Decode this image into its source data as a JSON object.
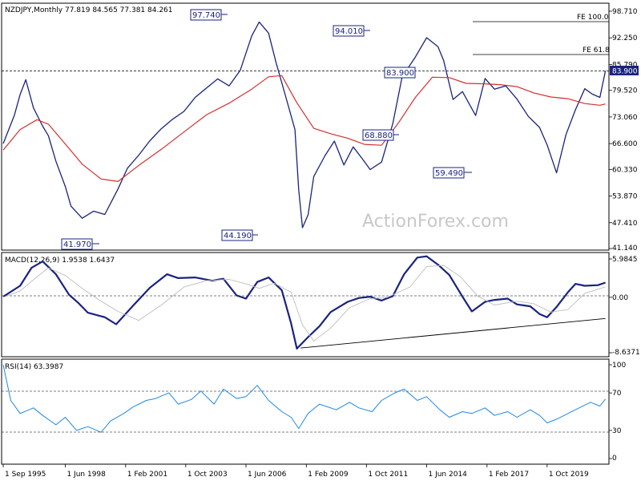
{
  "chart_data": [
    {
      "type": "line",
      "header": "NZDJPY,Monthly  77.819 84.565 77.381 84.261",
      "ylim": [
        41.14,
        98.71
      ],
      "y_ticks": [
        "98.710",
        "92.250",
        "85.790",
        "79.520",
        "73.060",
        "66.600",
        "60.330",
        "53.870",
        "47.410",
        "41.140"
      ],
      "current_price": 83.9,
      "current_price_label": "83.900",
      "x_ticks": [
        "1 Sep 1995",
        "1 Jun 1998",
        "1 Feb 2001",
        "1 Oct 2003",
        "1 Jun 2006",
        "1 Feb 2009",
        "1 Oct 2011",
        "1 Jun 2014",
        "1 Feb 2017",
        "1 Oct 2019"
      ],
      "series": [
        {
          "color": "#1a237e",
          "x": [
            "1995-09",
            "1996-03",
            "1996-06",
            "1996-09",
            "1997-01",
            "1997-06",
            "1997-09",
            "1998-01",
            "1998-06",
            "1998-09",
            "1999-03",
            "1999-09",
            "2000-03",
            "2000-10",
            "2001-03",
            "2001-09",
            "2002-03",
            "2002-09",
            "2003-03",
            "2003-09",
            "2004-03",
            "2004-09",
            "2005-03",
            "2005-09",
            "2006-03",
            "2006-09",
            "2007-01",
            "2007-06",
            "2007-10",
            "2008-03",
            "2008-08",
            "2008-10",
            "2008-12",
            "2009-03",
            "2009-06",
            "2009-12",
            "2010-05",
            "2010-10",
            "2011-03",
            "2011-08",
            "2011-12",
            "2012-06",
            "2012-12",
            "2013-05",
            "2013-12",
            "2014-06",
            "2014-12",
            "2015-03",
            "2015-08",
            "2016-01",
            "2016-08",
            "2017-01",
            "2017-06",
            "2017-12",
            "2018-06",
            "2018-12",
            "2019-06",
            "2019-10",
            "2020-03",
            "2020-08",
            "2021-01",
            "2021-06",
            "2021-10",
            "2022-02",
            "2022-05"
          ],
          "y": [
            66.6,
            73.5,
            78.5,
            82.1,
            75.3,
            70.8,
            68.5,
            62.3,
            56.2,
            51.4,
            48.5,
            50.2,
            49.4,
            55.6,
            60.6,
            63.8,
            67.3,
            70.2,
            72.5,
            74.4,
            77.8,
            80.1,
            82.3,
            80.6,
            84.4,
            92.7,
            96.1,
            93.4,
            86.2,
            78.2,
            70.0,
            55.4,
            46.2,
            49.3,
            58.6,
            63.7,
            67.2,
            61.4,
            65.8,
            62.8,
            60.3,
            62.1,
            71.5,
            82.8,
            87.6,
            92.3,
            90.1,
            86.8,
            77.3,
            79.2,
            73.4,
            82.4,
            79.8,
            80.6,
            77.4,
            73.2,
            70.5,
            66.3,
            59.5,
            68.8,
            74.8,
            79.9,
            78.6,
            77.8,
            84.26
          ]
        },
        {
          "color": "#d32f2f",
          "x": [
            "1995-09",
            "1996-06",
            "1997-03",
            "1997-09",
            "1998-06",
            "1999-03",
            "2000-01",
            "2000-10",
            "2001-09",
            "2002-09",
            "2003-09",
            "2004-09",
            "2005-09",
            "2006-09",
            "2007-06",
            "2008-01",
            "2008-09",
            "2009-06",
            "2010-03",
            "2010-12",
            "2011-09",
            "2012-06",
            "2013-03",
            "2013-12",
            "2014-09",
            "2015-06",
            "2016-03",
            "2016-12",
            "2017-09",
            "2018-06",
            "2019-03",
            "2019-12",
            "2020-09",
            "2021-06",
            "2022-02",
            "2022-05"
          ],
          "y": [
            65.0,
            70.0,
            72.4,
            71.3,
            66.5,
            61.6,
            58.0,
            57.4,
            61.3,
            65.2,
            69.4,
            73.6,
            76.4,
            79.8,
            82.8,
            83.1,
            76.5,
            70.3,
            69.0,
            67.9,
            66.4,
            66.2,
            71.6,
            77.8,
            82.7,
            82.6,
            81.2,
            81.1,
            80.9,
            80.4,
            78.9,
            77.9,
            77.5,
            76.3,
            75.9,
            76.2
          ]
        }
      ]
    },
    {
      "type": "line",
      "header": "MACD(12,26,9) 1.9538 1.6437",
      "ylim": [
        -8.6371,
        5.9845
      ],
      "y_ticks": [
        "5.9845",
        "0.00",
        "-8.6371"
      ],
      "series": [
        {
          "color": "#1a237e",
          "x": [
            "1995-09",
            "1996-06",
            "1996-12",
            "1997-06",
            "1998-01",
            "1998-08",
            "1999-01",
            "1999-06",
            "2000-03",
            "2000-09",
            "2001-06",
            "2002-03",
            "2002-12",
            "2003-06",
            "2004-03",
            "2004-12",
            "2005-06",
            "2006-01",
            "2006-06",
            "2006-12",
            "2007-06",
            "2008-01",
            "2008-06",
            "2008-09",
            "2009-03",
            "2009-09",
            "2010-03",
            "2010-12",
            "2011-06",
            "2011-12",
            "2012-06",
            "2012-12",
            "2013-06",
            "2014-01",
            "2014-06",
            "2014-12",
            "2015-06",
            "2016-01",
            "2016-06",
            "2017-01",
            "2017-06",
            "2018-01",
            "2018-06",
            "2019-01",
            "2019-06",
            "2019-10",
            "2020-03",
            "2020-09",
            "2021-01",
            "2021-06",
            "2022-01",
            "2022-05"
          ],
          "y": [
            0.1,
            1.8,
            4.6,
            5.6,
            3.6,
            0.4,
            -0.9,
            -2.4,
            -3.1,
            -4.2,
            -1.3,
            1.5,
            3.6,
            3.0,
            3.1,
            2.6,
            2.9,
            0.3,
            -0.2,
            2.4,
            3.1,
            1.1,
            -4.1,
            -8.0,
            -6.2,
            -4.5,
            -2.3,
            -0.7,
            -0.1,
            0.1,
            -0.5,
            0.2,
            3.6,
            6.2,
            6.4,
            5.1,
            3.5,
            0.1,
            -2.2,
            -0.7,
            -0.4,
            -0.2,
            -1.1,
            -1.4,
            -2.6,
            -3.1,
            -1.5,
            0.8,
            2.1,
            1.8,
            1.9,
            2.3
          ]
        },
        {
          "color": "#bdbdbd",
          "x": [
            "1995-09",
            "1996-06",
            "1997-03",
            "1997-09",
            "1998-06",
            "1999-03",
            "2000-01",
            "2000-10",
            "2001-09",
            "2002-09",
            "2003-09",
            "2004-09",
            "2005-09",
            "2006-06",
            "2007-01",
            "2007-09",
            "2008-06",
            "2008-12",
            "2009-06",
            "2010-03",
            "2011-01",
            "2011-12",
            "2012-09",
            "2013-09",
            "2014-06",
            "2015-03",
            "2015-12",
            "2016-09",
            "2017-06",
            "2018-06",
            "2019-03",
            "2019-12",
            "2020-09",
            "2021-06",
            "2022-05"
          ],
          "y": [
            0.0,
            1.0,
            3.2,
            4.6,
            3.4,
            1.4,
            -0.6,
            -2.2,
            -3.6,
            -1.2,
            1.6,
            2.6,
            2.8,
            2.1,
            1.4,
            2.2,
            0.8,
            -4.3,
            -6.8,
            -4.8,
            -1.6,
            -0.2,
            0.0,
            1.6,
            4.8,
            5.0,
            3.2,
            0.2,
            -1.2,
            -0.6,
            -1.0,
            -2.3,
            -1.9,
            0.6,
            1.64
          ]
        },
        {
          "color": "#000000",
          "x": [
            "2008-11",
            "2022-05"
          ],
          "y": [
            -7.9,
            -3.3
          ]
        }
      ]
    },
    {
      "type": "line",
      "header": "RSI(14) 63.3987",
      "ylim": [
        0,
        100
      ],
      "y_ticks": [
        "100",
        "70",
        "30",
        "0"
      ],
      "series": [
        {
          "color": "#1e88e5",
          "x": [
            "1995-09",
            "1996-01",
            "1996-06",
            "1997-01",
            "1997-06",
            "1998-01",
            "1998-06",
            "1998-12",
            "1999-06",
            "2000-01",
            "2000-06",
            "2001-01",
            "2001-06",
            "2002-01",
            "2002-06",
            "2003-01",
            "2003-06",
            "2004-01",
            "2004-06",
            "2005-01",
            "2005-06",
            "2006-01",
            "2006-06",
            "2006-12",
            "2007-06",
            "2008-01",
            "2008-06",
            "2008-10",
            "2009-03",
            "2009-09",
            "2010-06",
            "2011-01",
            "2011-06",
            "2012-01",
            "2012-06",
            "2013-01",
            "2013-06",
            "2014-01",
            "2014-06",
            "2015-01",
            "2015-06",
            "2016-01",
            "2016-06",
            "2017-01",
            "2017-06",
            "2018-01",
            "2018-06",
            "2019-01",
            "2019-06",
            "2019-10",
            "2020-03",
            "2020-09",
            "2021-03",
            "2021-09",
            "2022-02",
            "2022-05"
          ],
          "y": [
            100,
            62,
            48,
            54,
            46,
            36,
            44,
            30,
            34,
            28,
            40,
            48,
            55,
            62,
            64,
            70,
            58,
            63,
            72,
            58,
            74,
            64,
            66,
            78,
            62,
            50,
            44,
            32,
            48,
            58,
            52,
            60,
            54,
            50,
            62,
            70,
            74,
            62,
            66,
            52,
            44,
            50,
            48,
            54,
            46,
            50,
            44,
            52,
            46,
            38,
            42,
            48,
            54,
            60,
            56,
            63.4
          ]
        }
      ]
    }
  ],
  "annotations": {
    "peaks_and_troughs": [
      "97.740",
      "94.010",
      "83.900",
      "68.880",
      "59.490",
      "41.970",
      "44.190"
    ],
    "fe_labels": [
      "FE 100.0",
      "FE 61.8"
    ],
    "watermark": "ActionForex.com"
  }
}
